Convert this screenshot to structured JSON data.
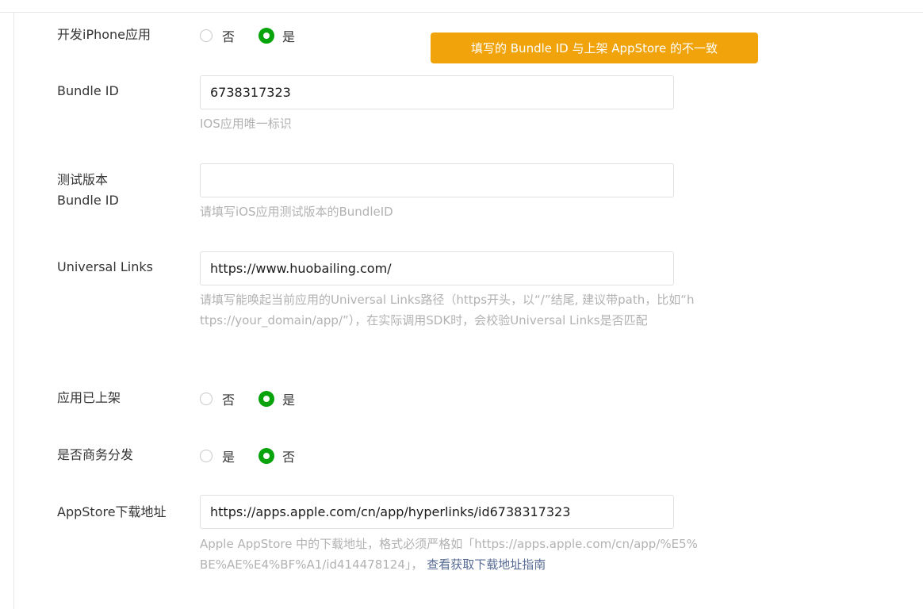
{
  "toast": {
    "message": "填写的 Bundle ID 与上架 AppStore 的不一致",
    "color": "#f0a30a"
  },
  "accent_color": "#07a30a",
  "iphone_app": {
    "label": "开发iPhone应用",
    "options": [
      {
        "label": "否",
        "checked": false
      },
      {
        "label": "是",
        "checked": true
      }
    ]
  },
  "bundle_id": {
    "label": "Bundle ID",
    "value": "6738317323",
    "hint": "IOS应用唯一标识"
  },
  "test_bundle_id": {
    "label": "测试版本\nBundle ID",
    "value": "",
    "hint": "请填写iOS应用测试版本的BundleID"
  },
  "universal_links": {
    "label": "Universal Links",
    "value": "https://www.huobailing.com/",
    "hint": "请填写能唤起当前应用的Universal Links路径（https开头，以“/”结尾, 建议带path，比如“https://your_domain/app/”），在实际调用SDK时，会校验Universal Links是否匹配"
  },
  "app_listed": {
    "label": "应用已上架",
    "options": [
      {
        "label": "否",
        "checked": false
      },
      {
        "label": "是",
        "checked": true
      }
    ]
  },
  "business_distribution": {
    "label": "是否商务分发",
    "options": [
      {
        "label": "是",
        "checked": false
      },
      {
        "label": "否",
        "checked": true
      }
    ]
  },
  "appstore_url": {
    "label": "AppStore下载地址",
    "value": "https://apps.apple.com/cn/app/hyperlinks/id6738317323",
    "hint": "Apple AppStore 中的下载地址，格式必须严格如「https://apps.apple.com/cn/app/%E5%BE%AE%E4%BF%A1/id414478124」，",
    "hint_link": "查看获取下载地址指南"
  }
}
